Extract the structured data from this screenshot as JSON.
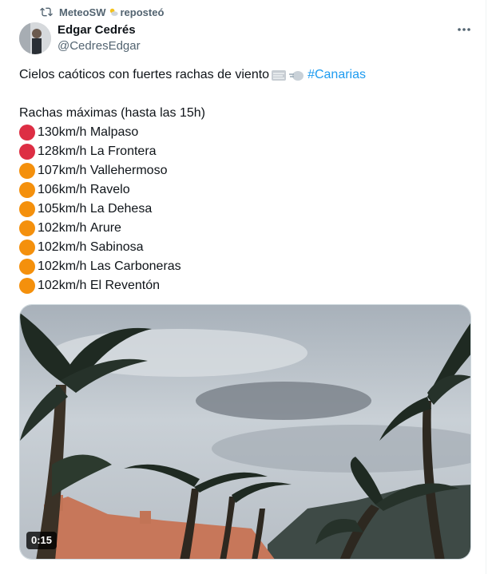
{
  "repost": {
    "by": "MeteoSW",
    "label": "reposteó",
    "icon": "repost-icon"
  },
  "author": {
    "name": "Edgar Cedrés",
    "handle": "@CedresEdgar"
  },
  "tweet": {
    "text": "Cielos caóticos con fuertes rachas de viento",
    "hashtag": "#Canarias",
    "heading": "Rachas máximas (hasta las 15h)",
    "items": [
      {
        "value": "130km/h",
        "place": "Malpaso",
        "color": "red"
      },
      {
        "value": "128km/h",
        "place": "La Frontera",
        "color": "red"
      },
      {
        "value": "107km/h",
        "place": "Vallehermoso",
        "color": "orange"
      },
      {
        "value": "106km/h",
        "place": "Ravelo",
        "color": "orange"
      },
      {
        "value": "105km/h",
        "place": "La Dehesa",
        "color": "orange"
      },
      {
        "value": "102km/h",
        "place": "Arure",
        "color": "orange"
      },
      {
        "value": "102km/h",
        "place": "Sabinosa",
        "color": "orange"
      },
      {
        "value": "102km/h",
        "place": "Las Carboneras",
        "color": "orange"
      },
      {
        "value": "102km/h",
        "place": "El Reventón",
        "color": "orange"
      }
    ]
  },
  "media": {
    "duration": "0:15"
  },
  "colors": {
    "red": "#dd2e44",
    "orange": "#f4900c",
    "link": "#1d9bf0",
    "secondary": "#536471"
  }
}
